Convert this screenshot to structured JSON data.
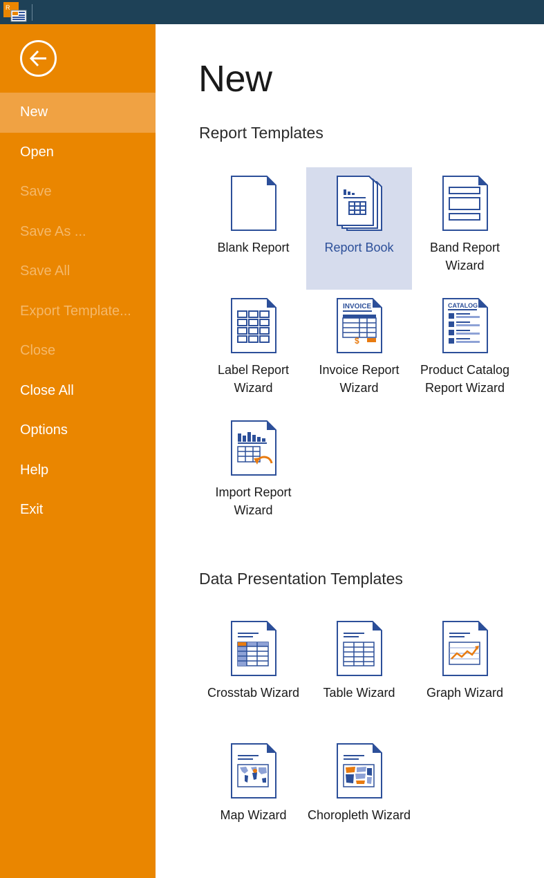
{
  "titlebar": {
    "app_icon": "report-designer-app-icon",
    "app_icon_letter": "R"
  },
  "sidebar": {
    "back_icon": "back-arrow-icon",
    "items": [
      {
        "label": "New",
        "state": "active"
      },
      {
        "label": "Open",
        "state": "enabled"
      },
      {
        "label": "Save",
        "state": "disabled"
      },
      {
        "label": "Save As ...",
        "state": "disabled"
      },
      {
        "label": "Save All",
        "state": "disabled"
      },
      {
        "label": "Export Template...",
        "state": "disabled"
      },
      {
        "label": "Close",
        "state": "disabled"
      },
      {
        "label": "Close All",
        "state": "enabled"
      },
      {
        "label": "Options",
        "state": "enabled"
      },
      {
        "label": "Help",
        "state": "enabled"
      },
      {
        "label": "Exit",
        "state": "enabled"
      }
    ]
  },
  "main": {
    "title": "New",
    "report_templates": {
      "title": "Report Templates",
      "items": [
        {
          "label": "Blank Report",
          "icon": "blank-report-icon"
        },
        {
          "label": "Report Book",
          "icon": "report-book-icon",
          "selected": true
        },
        {
          "label": "Band Report Wizard",
          "icon": "band-report-icon"
        },
        {
          "label": "Label Report Wizard",
          "icon": "label-report-icon"
        },
        {
          "label": "Invoice Report Wizard",
          "icon": "invoice-report-icon",
          "icon_text": "INVOICE"
        },
        {
          "label": "Product Catalog Report Wizard",
          "icon": "product-catalog-icon",
          "icon_text": "CATALOG"
        },
        {
          "label": "Import Report Wizard",
          "icon": "import-report-icon"
        }
      ]
    },
    "data_templates": {
      "title": "Data Presentation Templates",
      "items": [
        {
          "label": "Crosstab Wizard",
          "icon": "crosstab-icon"
        },
        {
          "label": "Table Wizard",
          "icon": "table-icon"
        },
        {
          "label": "Graph Wizard",
          "icon": "graph-icon"
        },
        {
          "label": "Map Wizard",
          "icon": "map-icon"
        },
        {
          "label": "Choropleth Wizard",
          "icon": "choropleth-icon"
        }
      ]
    }
  },
  "colors": {
    "titlebar": "#1e4157",
    "sidebar": "#ea8600",
    "sidebar_active": "#f0a243",
    "sidebar_disabled_text": "#f4b86a",
    "selected_tile": "#d6dced",
    "icon_blue": "#2c4f99",
    "icon_orange": "#e87b10"
  }
}
